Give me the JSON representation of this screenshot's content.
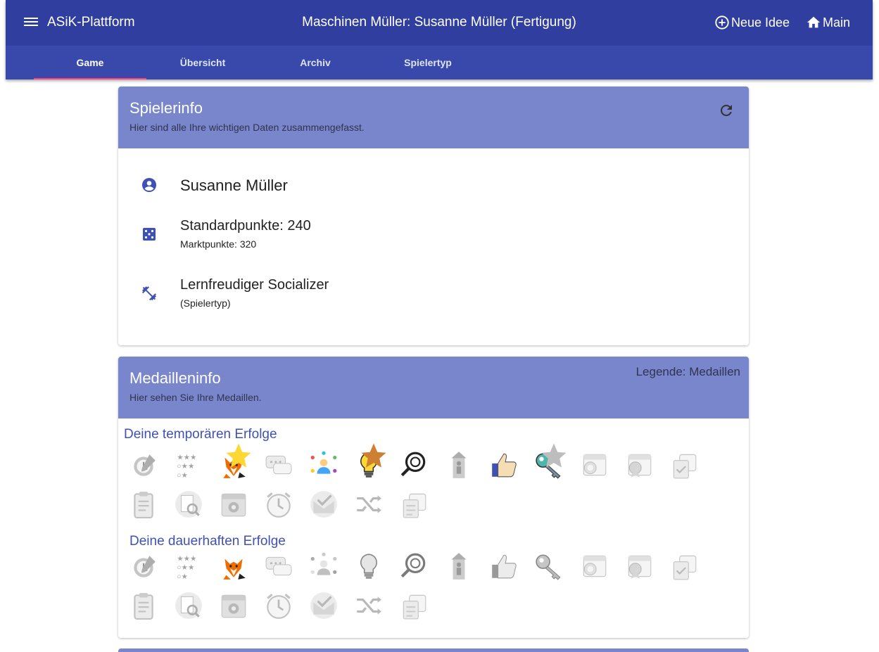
{
  "topbar": {
    "app_title": "ASiK-Plattform",
    "page_title": "Maschinen Müller: Susanne Müller (Fertigung)",
    "new_idea": "Neue Idee",
    "main": "Main",
    "color": "#303f9f"
  },
  "tabs": [
    {
      "label": "Game",
      "active": true
    },
    {
      "label": "Übersicht"
    },
    {
      "label": "Archiv"
    },
    {
      "label": "Spielertyp"
    }
  ],
  "player_card": {
    "title": "Spielerinfo",
    "subtitle": "Hier sind alle Ihre wichtigen Daten zusammengefasst.",
    "name": "Susanne Müller",
    "standard_points": "Standardpunkte: 240",
    "market_points": "Marktpunkte: 320",
    "player_type": "Lernfreudiger Socializer",
    "player_type_note": "(Spielertyp)"
  },
  "medal_card": {
    "title": "Medailleninfo",
    "subtitle": "Hier sehen Sie Ihre Medaillen.",
    "legend": "Legende: Medaillen",
    "temporary_title": "Deine temporären Erfolge",
    "permanent_title": "Deine dauerhaften Erfolge",
    "temporary_badges": [
      {
        "icon": "writing-clock-icon",
        "active": false
      },
      {
        "icon": "star-rating-icon",
        "active": false
      },
      {
        "icon": "fox-icon",
        "active": true,
        "star": "gold"
      },
      {
        "icon": "chat-bubbles-icon",
        "active": false
      },
      {
        "icon": "network-person-icon",
        "active": true
      },
      {
        "icon": "lightbulb-icon",
        "active": true,
        "star": "bronze"
      },
      {
        "icon": "magnifier-film-icon",
        "active": true
      },
      {
        "icon": "tower-person-icon",
        "active": false
      },
      {
        "icon": "thumbs-up-icon",
        "active": true
      },
      {
        "icon": "key-icon",
        "active": true,
        "star": "silver"
      },
      {
        "icon": "calendar-award-icon",
        "active": false
      },
      {
        "icon": "calendar-medal-icon",
        "active": false
      },
      {
        "icon": "calendar-check-icon",
        "active": false
      },
      {
        "icon": "clipboard-icon",
        "active": false
      },
      {
        "icon": "document-search-icon",
        "active": false
      },
      {
        "icon": "calendar-gear-icon",
        "active": false
      },
      {
        "icon": "alarm-clock-icon",
        "active": false
      },
      {
        "icon": "envelope-check-icon",
        "active": false
      },
      {
        "icon": "shuffle-icon",
        "active": false
      },
      {
        "icon": "calendar-doc-icon",
        "active": false
      }
    ],
    "permanent_badges": [
      {
        "icon": "writing-clock-icon",
        "active": false
      },
      {
        "icon": "star-rating-icon",
        "active": false
      },
      {
        "icon": "fox-icon",
        "active": true
      },
      {
        "icon": "chat-bubbles-icon",
        "active": false
      },
      {
        "icon": "network-person-icon",
        "active": false
      },
      {
        "icon": "lightbulb-icon",
        "active": false
      },
      {
        "icon": "magnifier-film-icon",
        "active": false
      },
      {
        "icon": "tower-person-icon",
        "active": false
      },
      {
        "icon": "thumbs-up-icon",
        "active": false
      },
      {
        "icon": "key-icon",
        "active": false
      },
      {
        "icon": "calendar-award-icon",
        "active": false
      },
      {
        "icon": "calendar-medal-icon",
        "active": false
      },
      {
        "icon": "calendar-check-icon",
        "active": false
      },
      {
        "icon": "clipboard-icon",
        "active": false
      },
      {
        "icon": "document-search-icon",
        "active": false
      },
      {
        "icon": "calendar-gear-icon",
        "active": false
      },
      {
        "icon": "alarm-clock-icon",
        "active": false
      },
      {
        "icon": "envelope-check-icon",
        "active": false
      },
      {
        "icon": "shuffle-icon",
        "active": false
      },
      {
        "icon": "calendar-doc-icon",
        "active": false
      }
    ]
  },
  "colors": {
    "toolbar": "#303f9f",
    "tabs": "#3949ab",
    "card_header": "#7986cb",
    "accent": "#3f51b5",
    "tab_indicator": "#ff4081"
  }
}
